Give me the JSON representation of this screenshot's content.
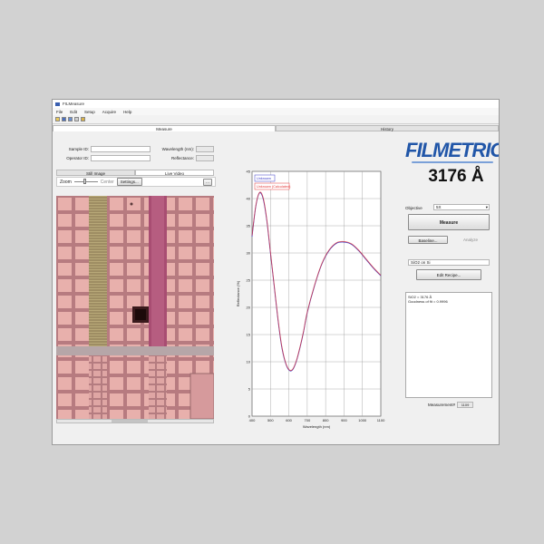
{
  "window": {
    "title": "FILMeasure"
  },
  "menu": [
    "File",
    "Edit",
    "Setup",
    "Acquire",
    "Help"
  ],
  "tabs": {
    "measure": "Measure",
    "history": "History"
  },
  "fields": {
    "sample_id_label": "Sample ID:",
    "operator_id_label": "Operator ID:",
    "wavelength_label": "Wavelength (nm):",
    "reflectance_label": "Reflectance:"
  },
  "image_tabs": {
    "still": "Still Image",
    "live": "Live Video"
  },
  "zoom": {
    "label": "Zoom",
    "center": "Center",
    "settings": "Settings...",
    "more": "..."
  },
  "brand": {
    "logo": "FILMETRICS",
    "thickness": "3176 Å"
  },
  "controls": {
    "objective_label": "Objective",
    "objective_value": "5X",
    "measure": "Measure",
    "baseline": "Baseline...",
    "analyze": "Analyze",
    "recipe_value": "SiO2 on Si",
    "edit_recipe": "Edit Recipe..."
  },
  "results": {
    "line1": "SiO2 = 3176 Å",
    "line2": "Goodness of fit = 0.9996"
  },
  "measurement_label": "Measurement#",
  "measurement_value": "1109",
  "colors": {
    "accent": "#2156a8",
    "measured": "#3a3ac8",
    "calculated": "#e23a3a"
  },
  "chart_data": {
    "type": "line",
    "xlabel": "Wavelength (nm)",
    "ylabel": "Reflectance (%)",
    "xlim": [
      400,
      1100
    ],
    "ylim": [
      0,
      45
    ],
    "xticks": [
      400,
      500,
      600,
      700,
      800,
      900,
      1000,
      1100
    ],
    "yticks": [
      0,
      5,
      10,
      15,
      20,
      25,
      30,
      35,
      40,
      45
    ],
    "grid": true,
    "legend_position": "top-left",
    "series": [
      {
        "name": "Unknown",
        "x": [
          400,
          420,
          440,
          460,
          480,
          500,
          520,
          540,
          560,
          580,
          600,
          620,
          640,
          660,
          680,
          700,
          740,
          780,
          820,
          860,
          900,
          940,
          980,
          1020,
          1060,
          1100
        ],
        "y": [
          33,
          38.5,
          41,
          40,
          36,
          30,
          24,
          18,
          13,
          10,
          8.5,
          8.5,
          10,
          12.5,
          15.5,
          19,
          24,
          28,
          30.5,
          31.8,
          32,
          31.6,
          30.4,
          28.8,
          27.2,
          25.8
        ]
      },
      {
        "name": "Unknown (Calculated)",
        "x": [
          400,
          420,
          440,
          460,
          480,
          500,
          520,
          540,
          560,
          580,
          600,
          620,
          640,
          660,
          680,
          700,
          740,
          780,
          820,
          860,
          900,
          940,
          980,
          1020,
          1060,
          1100
        ],
        "y": [
          33.2,
          38.6,
          41.1,
          40.2,
          36.2,
          30.2,
          24.2,
          18.2,
          13.2,
          10.1,
          8.6,
          8.6,
          10.1,
          12.6,
          15.6,
          19.1,
          24.1,
          28.1,
          30.6,
          31.9,
          32.1,
          31.7,
          30.5,
          28.9,
          27.3,
          25.9
        ]
      }
    ]
  }
}
